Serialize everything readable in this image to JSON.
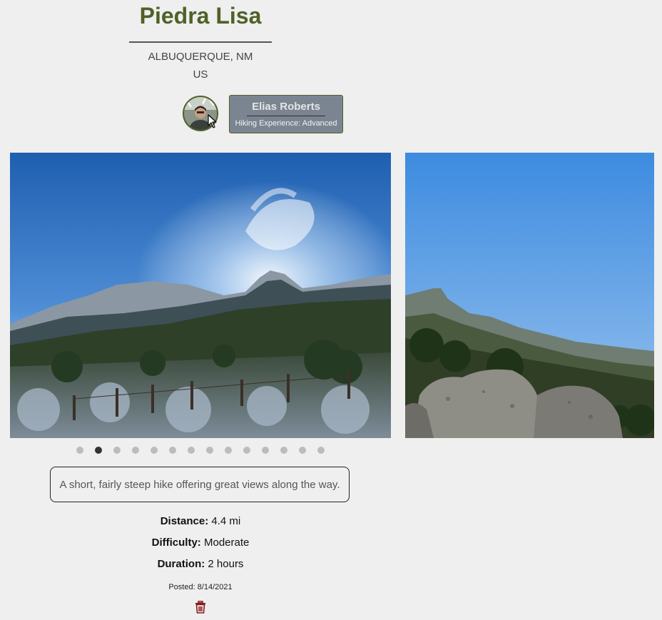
{
  "trail": {
    "name": "Piedra Lisa",
    "city_state": "ALBUQUERQUE, NM",
    "country": "US",
    "description": "A short, fairly steep hike offering great views along the way."
  },
  "author": {
    "name": "Elias Roberts",
    "experience": "Hiking Experience: Advanced"
  },
  "carousel": {
    "total_slides": 14,
    "active_index": 1
  },
  "stats": {
    "distance_label": "Distance:",
    "distance_value": " 4.4 mi",
    "difficulty_label": "Difficulty:",
    "difficulty_value": " Moderate",
    "duration_label": "Duration:",
    "duration_value": " 2 hours"
  },
  "posted": "Posted: 8/14/2021",
  "colors": {
    "title": "#4f6128",
    "card_bg": "#7b8591",
    "delete_icon": "#8b1a1a",
    "background": "#efefef"
  },
  "icons": {
    "delete": "trash-icon",
    "cursor": "mouse-pointer-icon"
  }
}
